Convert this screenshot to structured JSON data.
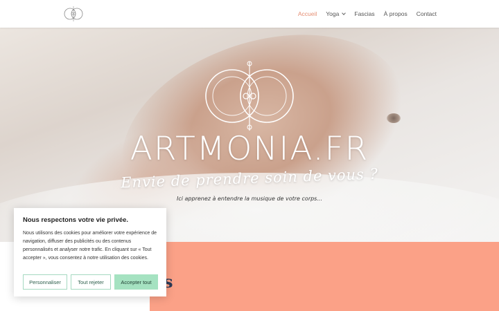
{
  "header": {
    "logo_icon": "artmonia-logo-icon",
    "nav": [
      {
        "label": "Accueil",
        "active": true
      },
      {
        "label": "Yoga",
        "has_dropdown": true
      },
      {
        "label": "Fascias"
      },
      {
        "label": "À propos"
      },
      {
        "label": "Contact"
      }
    ]
  },
  "hero": {
    "title": "ARTMONIA.FR",
    "script_line": "Envie de prendre soin de vous ?",
    "subtitle": "Ici apprenez à entendre la musique de votre corps..."
  },
  "section": {
    "partial_heading_letter": "s"
  },
  "cookie_banner": {
    "title": "Nous respectons votre vie privée.",
    "text": "Nous utilisons des cookies pour améliorer votre expérience de navigation, diffuser des publicités ou des contenus personnalisés et analyser notre trafic. En cliquant sur « Tout accepter », vous consentez à notre utilisation des cookies.",
    "buttons": {
      "customize": "Personnaliser",
      "reject": "Tout rejeter",
      "accept": "Accepter tout"
    }
  },
  "colors": {
    "accent": "#e58d72",
    "salmon": "#fba187",
    "accept_button": "#a5e2c1",
    "heading_navy": "#2d3a56"
  }
}
